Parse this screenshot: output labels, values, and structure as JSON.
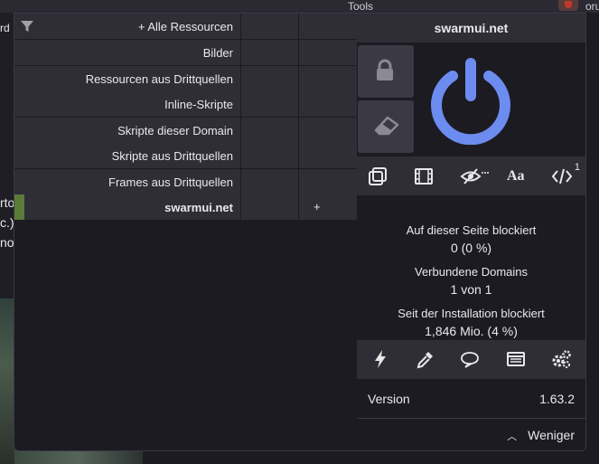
{
  "background": {
    "left_fragments": [
      "rd",
      "rto",
      "c.)",
      "nor"
    ],
    "top_fragments": [
      "Tools",
      "oru"
    ]
  },
  "firewall": {
    "rows": [
      {
        "label": "+ Alle Ressourcen"
      },
      {
        "label": "Bilder"
      },
      {
        "label": "Ressourcen aus Drittquellen"
      },
      {
        "label": "Inline-Skripte"
      },
      {
        "label": "Skripte dieser Domain"
      },
      {
        "label": "Skripte aus Drittquellen"
      },
      {
        "label": "Frames aus Drittquellen"
      },
      {
        "label": "swarmui.net"
      }
    ],
    "domain_plus": "+"
  },
  "panel": {
    "hostname": "swarmui.net",
    "toolbar": {
      "scripts_badge": "1",
      "fonts_label": "Aa"
    },
    "stats": {
      "blocked_page_label": "Auf dieser Seite blockiert",
      "blocked_page_value": "0 (0 %)",
      "domains_label": "Verbundene Domains",
      "domains_value": "1 von 1",
      "since_install_label": "Seit der Installation blockiert",
      "since_install_value": "1,846 Mio. (4 %)"
    },
    "version_label": "Version",
    "version_value": "1.63.2",
    "less_label": "Weniger"
  },
  "colors": {
    "accent_blue": "#6d8cf0",
    "panel_bg": "#1c1b22",
    "row_bg": "#2f2e37",
    "green_mark": "#5b7b3a"
  }
}
